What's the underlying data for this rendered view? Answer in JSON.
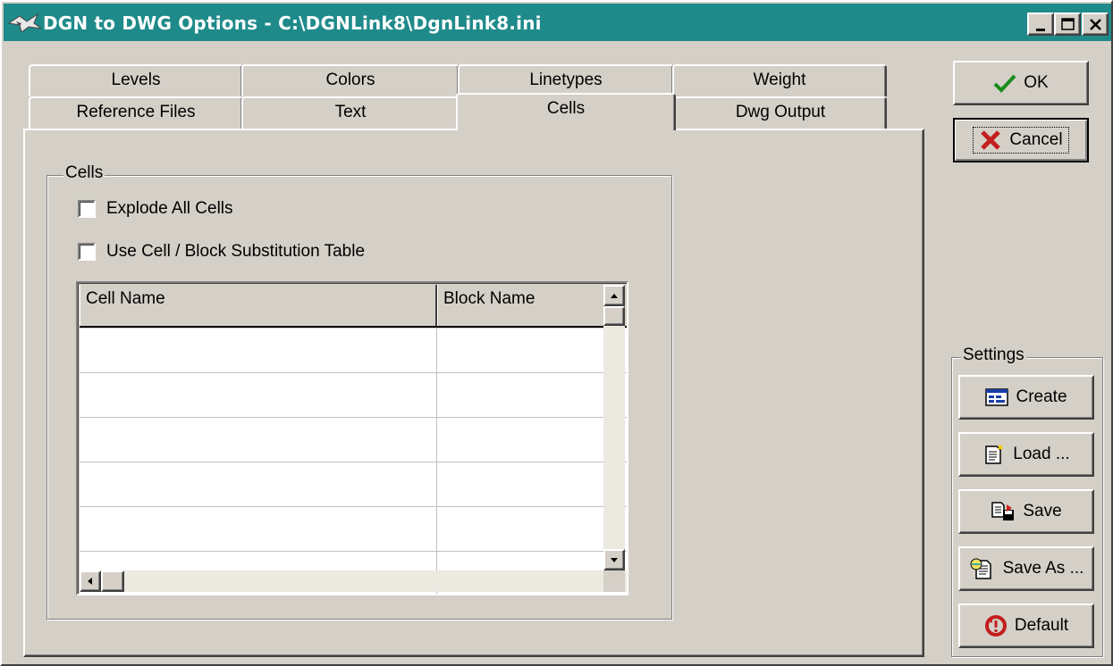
{
  "window": {
    "title": "DGN to DWG Options - C:\\DGNLink8\\DgnLink8.ini"
  },
  "tabs": {
    "row1": [
      {
        "label": "Levels"
      },
      {
        "label": "Colors"
      },
      {
        "label": "Linetypes"
      },
      {
        "label": "Weight"
      }
    ],
    "row2": [
      {
        "label": "Reference Files"
      },
      {
        "label": "Text"
      },
      {
        "label": "Cells",
        "active": true
      },
      {
        "label": "Dwg Output"
      }
    ]
  },
  "cells_panel": {
    "group_label": "Cells",
    "explode_all_cells": {
      "label": "Explode All Cells",
      "checked": false
    },
    "use_substitution_table": {
      "label": "Use Cell / Block Substitution Table",
      "checked": false
    },
    "table": {
      "columns": [
        "Cell Name",
        "Block Name"
      ],
      "rows": [
        [
          "",
          ""
        ],
        [
          "",
          ""
        ],
        [
          "",
          ""
        ],
        [
          "",
          ""
        ],
        [
          "",
          ""
        ],
        [
          "",
          ""
        ]
      ]
    }
  },
  "buttons": {
    "ok": "OK",
    "cancel": "Cancel"
  },
  "settings": {
    "label": "Settings",
    "create": "Create",
    "load": "Load ...",
    "save": "Save",
    "save_as": "Save As ...",
    "default": "Default"
  }
}
